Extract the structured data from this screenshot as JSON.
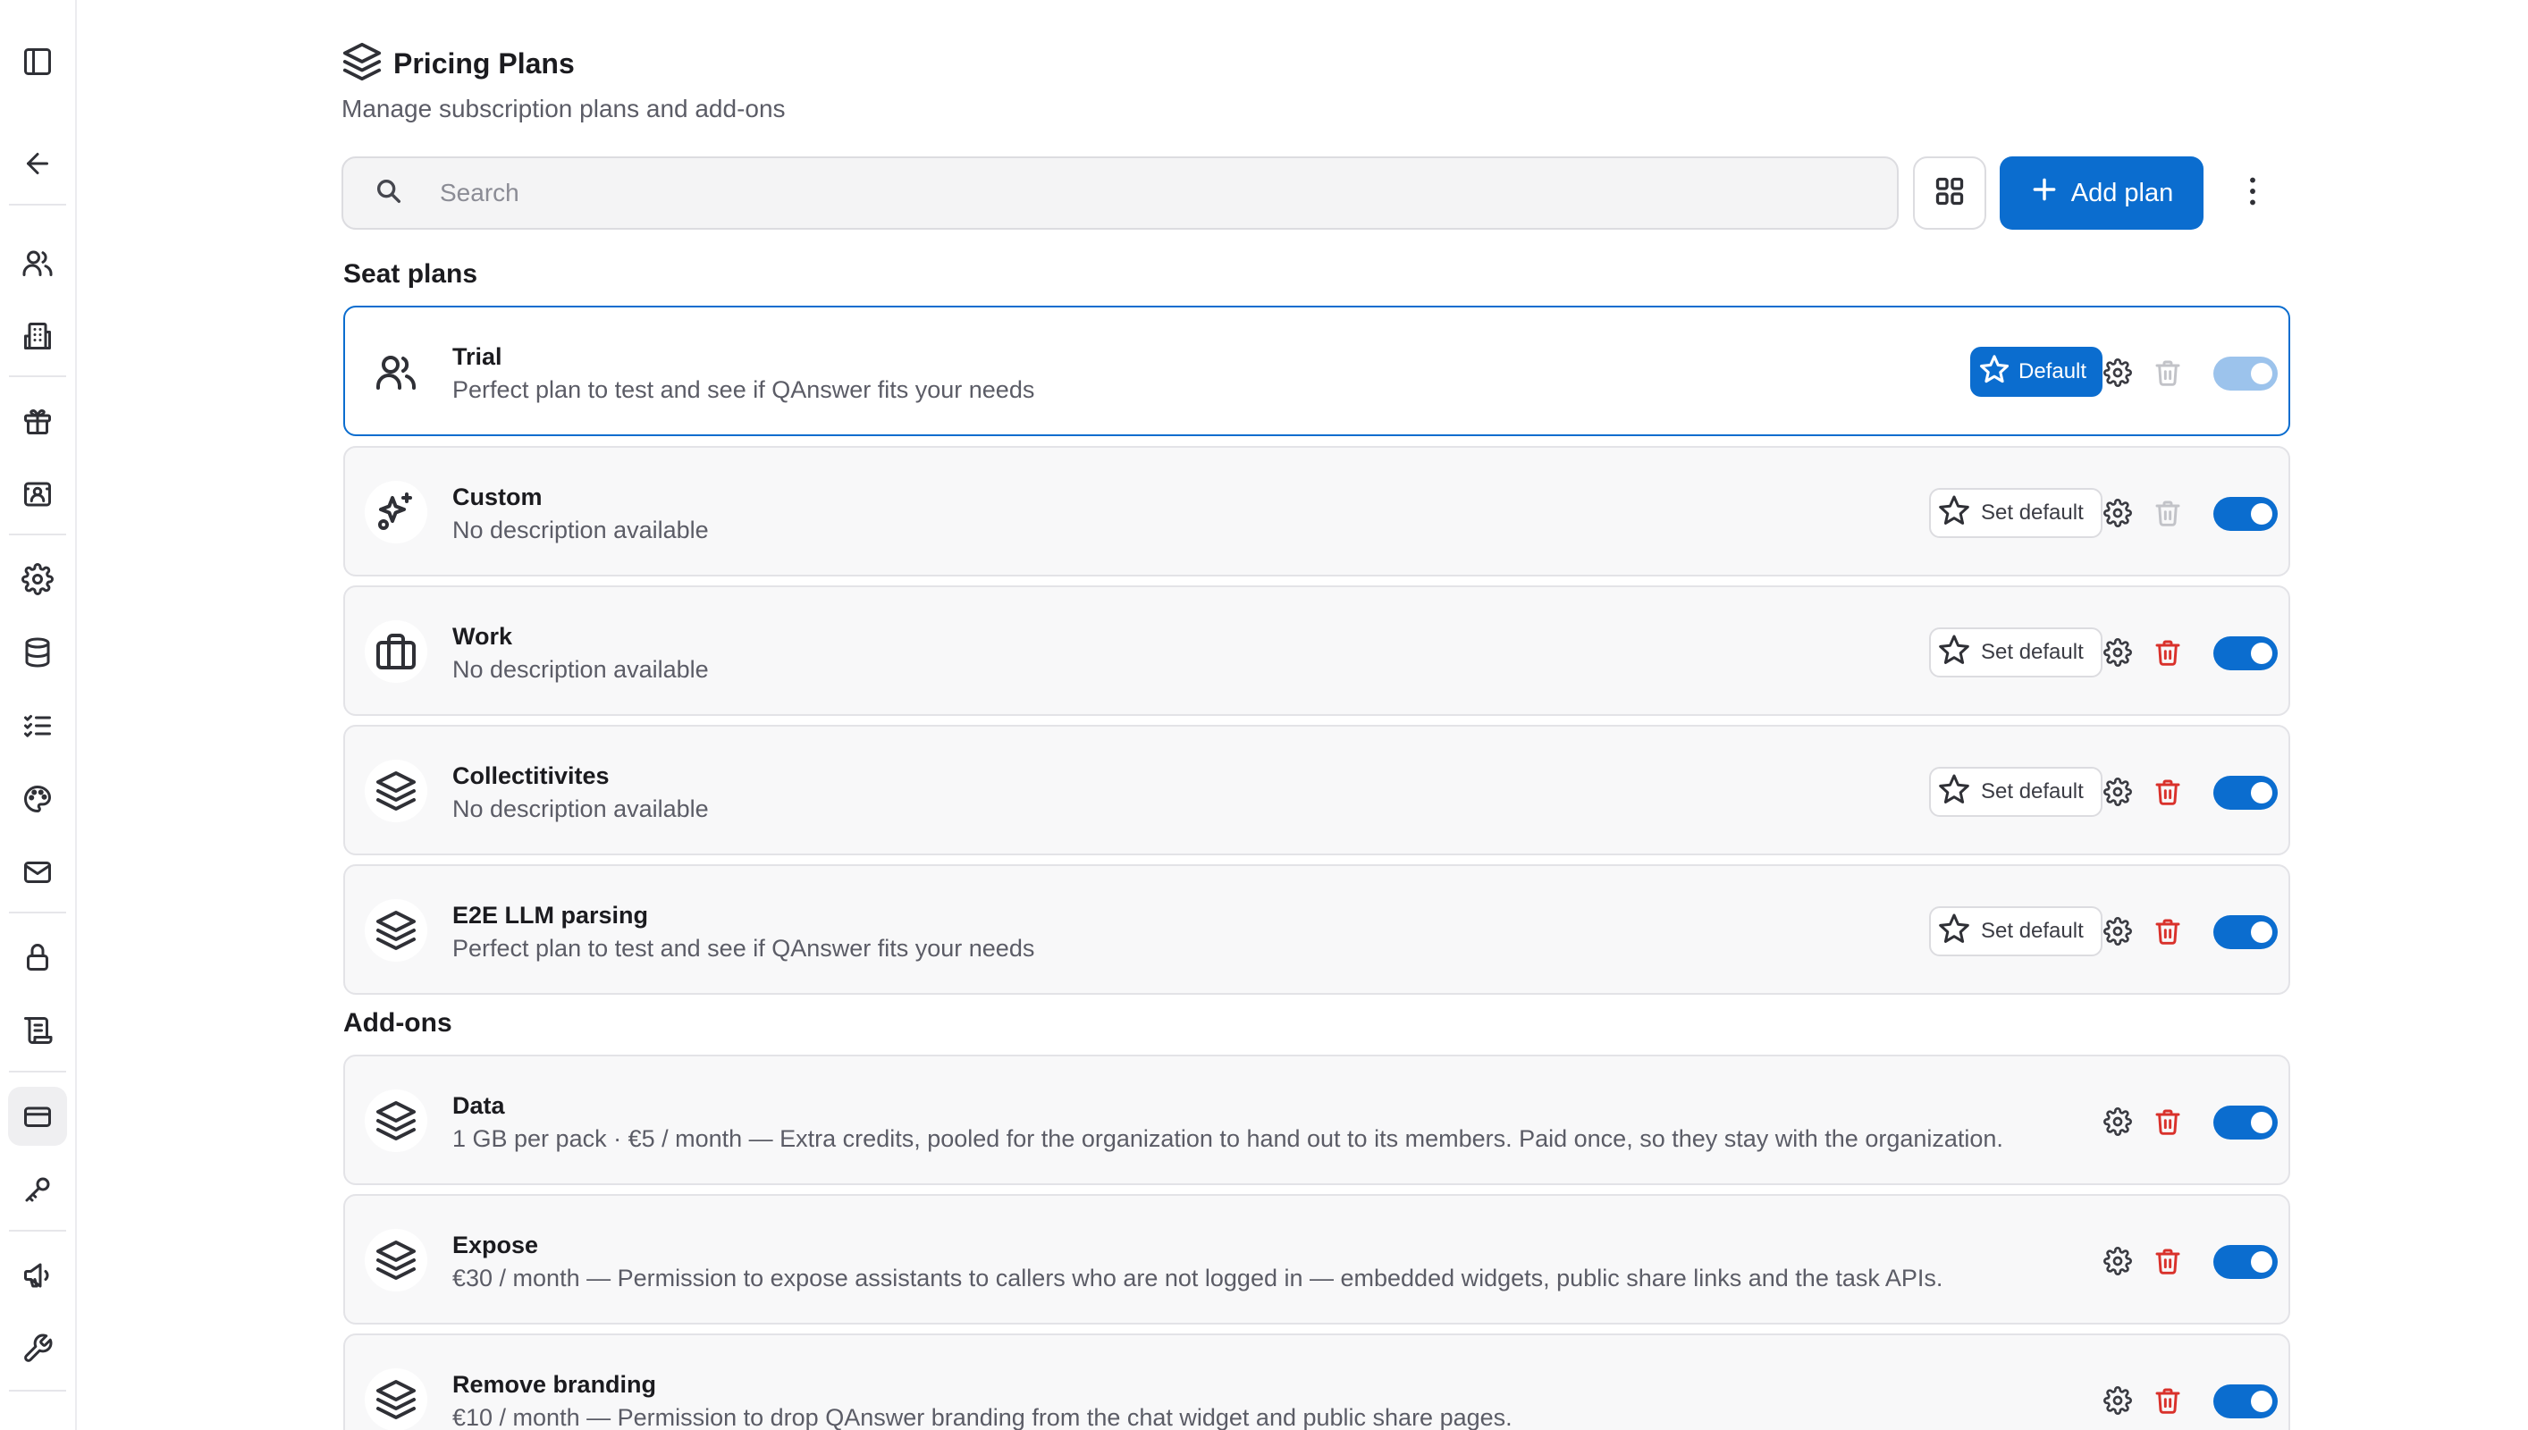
{
  "sidebar": {
    "items": [
      {
        "name": "toggle-sidebar-icon",
        "icon": "panel-left"
      },
      {
        "name": "back-arrow-icon",
        "icon": "arrow-left"
      },
      {
        "name": "users-icon",
        "icon": "users"
      },
      {
        "name": "organization-icon",
        "icon": "building"
      },
      {
        "name": "gift-icon",
        "icon": "gift"
      },
      {
        "name": "id-card-icon",
        "icon": "id-card"
      },
      {
        "name": "gear-icon",
        "icon": "settings"
      },
      {
        "name": "database-icon",
        "icon": "database"
      },
      {
        "name": "checklist-icon",
        "icon": "list-checks"
      },
      {
        "name": "palette-icon",
        "icon": "palette"
      },
      {
        "name": "mail-icon",
        "icon": "mail"
      },
      {
        "name": "lock-icon",
        "icon": "lock"
      },
      {
        "name": "scroll-icon",
        "icon": "scroll"
      },
      {
        "name": "credit-card-icon",
        "icon": "credit-card",
        "active": true
      },
      {
        "name": "key-icon",
        "icon": "key"
      },
      {
        "name": "megaphone-icon",
        "icon": "megaphone"
      },
      {
        "name": "wrench-icon",
        "icon": "wrench"
      }
    ]
  },
  "header": {
    "title": "Pricing Plans",
    "subtitle": "Manage subscription plans and add-ons"
  },
  "toolbar": {
    "search_placeholder": "Search",
    "add_label": "Add plan"
  },
  "seat_plans": {
    "title": "Seat plans",
    "items": [
      {
        "name": "Trial",
        "description": "Perfect plan to test and see if QAnswer fits your needs",
        "icon": "users-icon",
        "is_default": true,
        "badge_label": "Default",
        "enabled": true,
        "deletable": false
      },
      {
        "name": "Custom",
        "description": "No description available",
        "icon": "sparkles-icon",
        "is_default": false,
        "set_default_label": "Set default",
        "enabled": true,
        "deletable": false
      },
      {
        "name": "Work",
        "description": "No description available",
        "icon": "briefcase-icon",
        "is_default": false,
        "set_default_label": "Set default",
        "enabled": true,
        "deletable": true
      },
      {
        "name": "Collectitivites",
        "description": "No description available",
        "icon": "layers-icon",
        "is_default": false,
        "set_default_label": "Set default",
        "enabled": true,
        "deletable": true
      },
      {
        "name": "E2E LLM parsing",
        "description": "Perfect plan to test and see if QAnswer fits your needs",
        "icon": "layers-icon",
        "is_default": false,
        "set_default_label": "Set default",
        "enabled": true,
        "deletable": true
      }
    ]
  },
  "addons": {
    "title": "Add-ons",
    "items": [
      {
        "name": "Data",
        "description": "1 GB per pack · €5 / month — Extra credits, pooled for the organization to hand out to its members. Paid once, so they stay with the organization.",
        "icon": "layers-icon",
        "enabled": true
      },
      {
        "name": "Expose",
        "description": "€30 / month — Permission to expose assistants to callers who are not logged in — embedded widgets, public share links and the task APIs.",
        "icon": "layers-icon",
        "enabled": true
      },
      {
        "name": "Remove branding",
        "description": "€10 / month — Permission to drop QAnswer branding from the chat widget and public share pages.",
        "icon": "layers-icon",
        "enabled": true
      }
    ]
  },
  "colors": {
    "accent": "#0b6dcf",
    "delete": "#d9312b",
    "card_bg": "#f8f8f9",
    "border": "#e3e3e7"
  }
}
